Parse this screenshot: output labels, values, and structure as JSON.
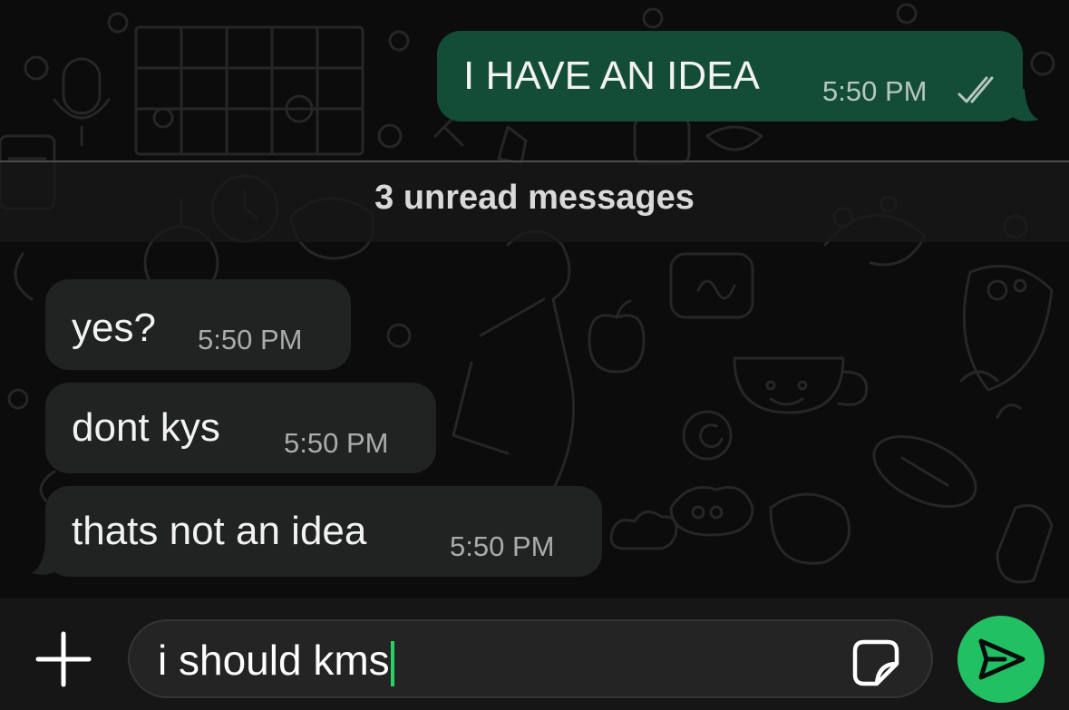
{
  "chat": {
    "messages": [
      {
        "direction": "outgoing",
        "text": "I HAVE AN IDEA",
        "time": "5:50 PM",
        "status": "read"
      },
      {
        "direction": "incoming",
        "text": "yes?",
        "time": "5:50 PM"
      },
      {
        "direction": "incoming",
        "text": "dont kys",
        "time": "5:50 PM"
      },
      {
        "direction": "incoming",
        "text": "thats not an idea",
        "time": "5:50 PM"
      }
    ],
    "unread_divider": "3 unread messages"
  },
  "composer": {
    "input_value": "i should kms",
    "icons": {
      "attach": "plus-icon",
      "sticker": "sticker-icon",
      "send": "send-icon"
    }
  },
  "colors": {
    "outgoing_bubble": "#144d37",
    "incoming_bubble": "#202322",
    "send_button": "#21c063",
    "caret": "#25d366",
    "read_ticks": "#b6c7bd"
  }
}
